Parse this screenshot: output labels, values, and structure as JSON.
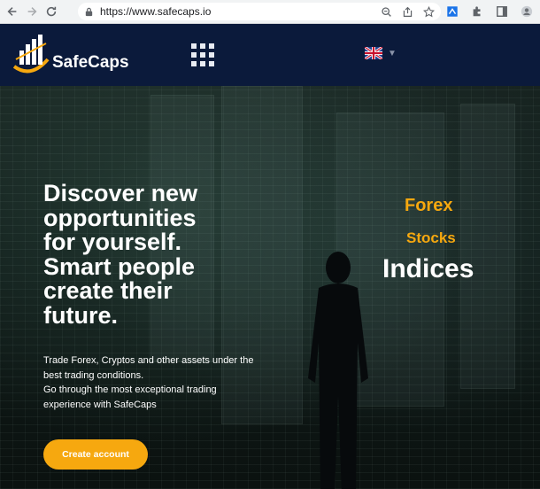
{
  "browser": {
    "url": "https://www.safecaps.io"
  },
  "header": {
    "logo_text": "SafeCaps",
    "language": "English (UK)"
  },
  "hero": {
    "headline_lines": [
      "Discover new",
      "opportunities",
      "for yourself.",
      "Smart people",
      "create their",
      "future."
    ],
    "sub_lines": [
      "Trade Forex, Cryptos and other assets under the",
      "best trading conditions.",
      "Go through the most exceptional trading",
      "experience with SafeCaps"
    ],
    "cta_label": "Create account",
    "words": [
      "Forex",
      "Stocks",
      "Indices"
    ]
  },
  "colors": {
    "header_bg": "#0b1a3b",
    "accent": "#f6a80f",
    "text": "#ffffff"
  }
}
